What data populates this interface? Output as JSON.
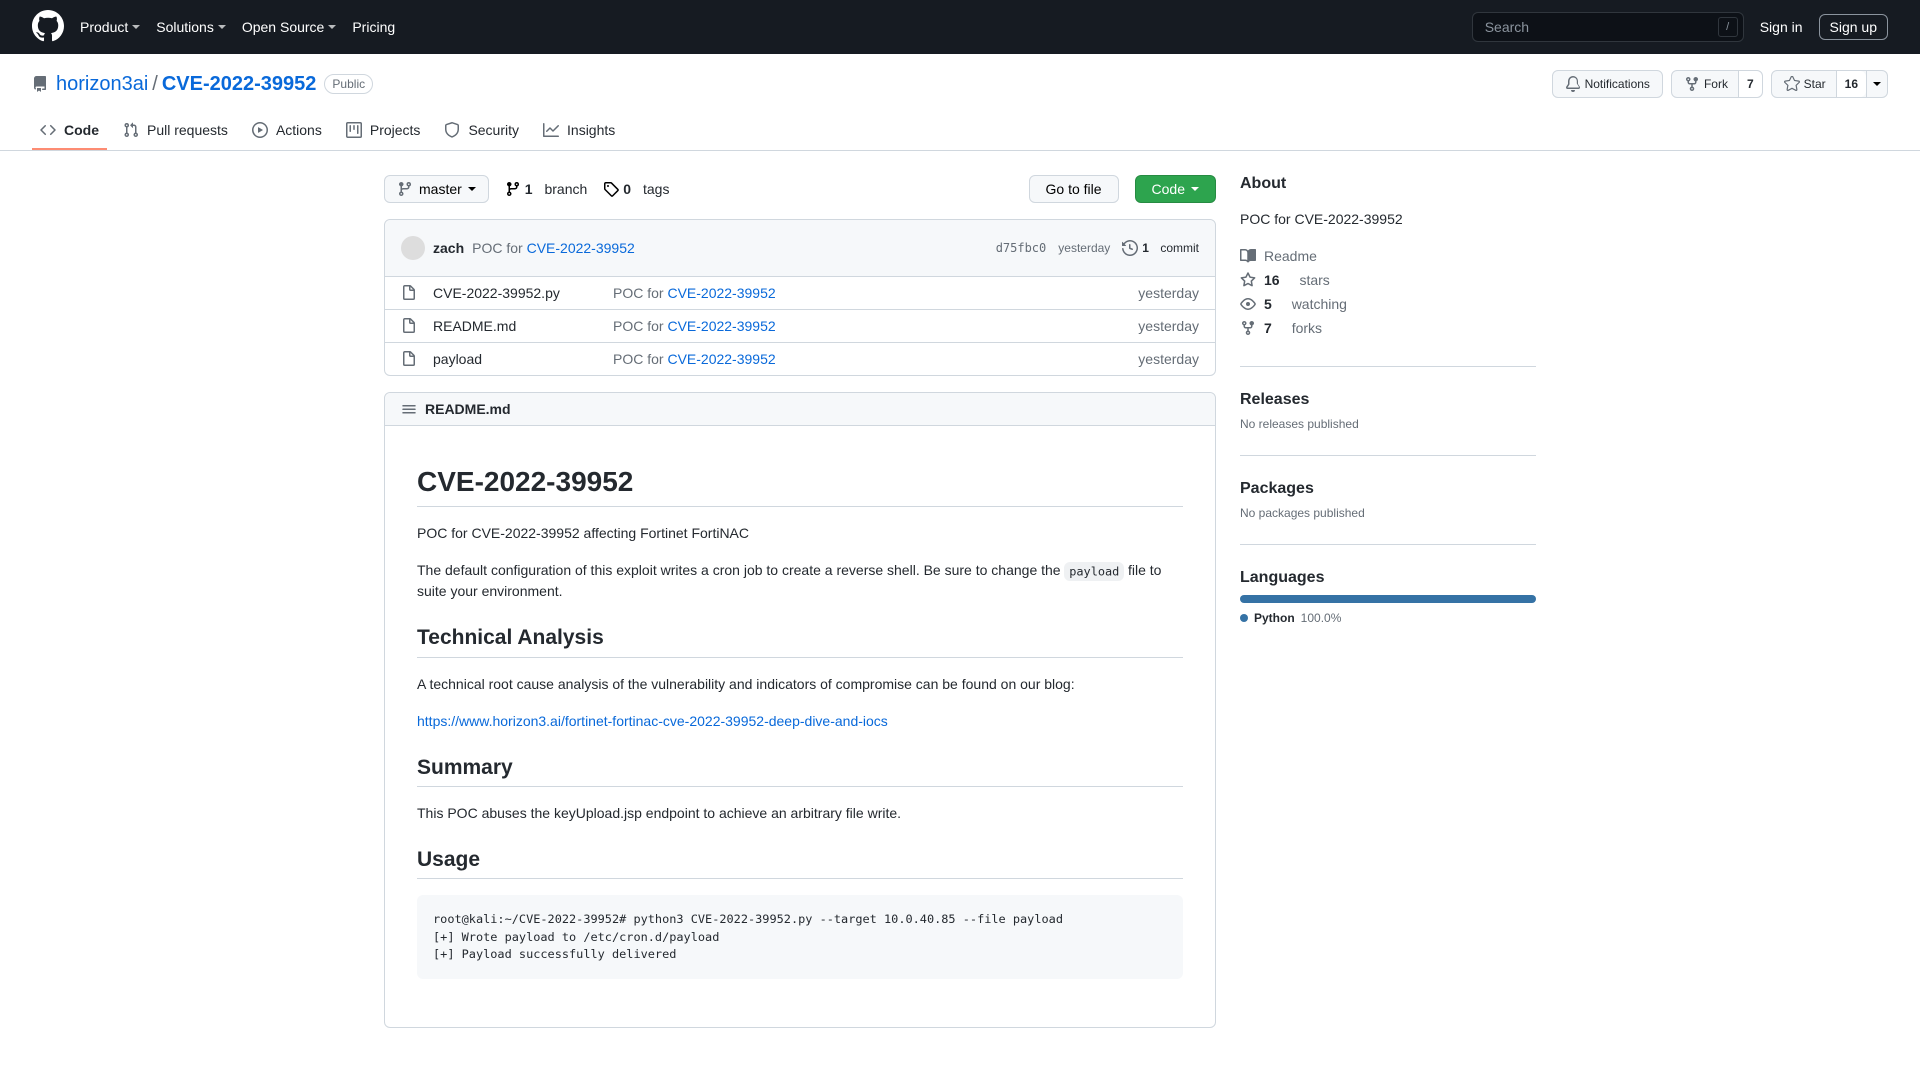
{
  "header": {
    "nav": [
      "Product",
      "Solutions",
      "Open Source",
      "Pricing"
    ],
    "search_placeholder": "Search",
    "signin": "Sign in",
    "signup": "Sign up"
  },
  "repo": {
    "owner": "horizon3ai",
    "name": "CVE-2022-39952",
    "badge": "Public",
    "actions": {
      "notifications": "Notifications",
      "fork": "Fork",
      "fork_count": "7",
      "star": "Star",
      "star_count": "16"
    }
  },
  "tabs": {
    "code": "Code",
    "pull_requests": "Pull requests",
    "actions": "Actions",
    "projects": "Projects",
    "security": "Security",
    "insights": "Insights"
  },
  "toolbar": {
    "branch": "master",
    "branches_count": "1",
    "branches_label": "branch",
    "tags_count": "0",
    "tags_label": "tags",
    "gotofile": "Go to file",
    "code": "Code"
  },
  "commit": {
    "author": "zach",
    "msg_prefix": "POC for ",
    "msg_link": "CVE-2022-39952",
    "sha": "d75fbc0",
    "date": "yesterday",
    "commits_count": "1",
    "commits_label": "commit"
  },
  "files": [
    {
      "name": "CVE-2022-39952.py",
      "msg_prefix": "POC for ",
      "msg_link": "CVE-2022-39952",
      "date": "yesterday"
    },
    {
      "name": "README.md",
      "msg_prefix": "POC for ",
      "msg_link": "CVE-2022-39952",
      "date": "yesterday"
    },
    {
      "name": "payload",
      "msg_prefix": "POC for ",
      "msg_link": "CVE-2022-39952",
      "date": "yesterday"
    }
  ],
  "readme": {
    "filename": "README.md",
    "h1": "CVE-2022-39952",
    "p1": "POC for CVE-2022-39952 affecting Fortinet FortiNAC",
    "p2a": "The default configuration of this exploit writes a cron job to create a reverse shell. Be sure to change the ",
    "p2_code": "payload",
    "p2b": " file to suite your environment.",
    "h2_tech": "Technical Analysis",
    "p3": "A technical root cause analysis of the vulnerability and indicators of compromise can be found on our blog:",
    "link": "https://www.horizon3.ai/fortinet-fortinac-cve-2022-39952-deep-dive-and-iocs",
    "h2_summary": "Summary",
    "p4": "This POC abuses the keyUpload.jsp endpoint to achieve an arbitrary file write.",
    "h2_usage": "Usage",
    "code": "root@kali:~/CVE-2022-39952# python3 CVE-2022-39952.py --target 10.0.40.85 --file payload\n[+] Wrote payload to /etc/cron.d/payload\n[+] Payload successfully delivered"
  },
  "about": {
    "title": "About",
    "desc": "POC for CVE-2022-39952",
    "readme": "Readme",
    "stars_count": "16",
    "stars_label": "stars",
    "watching_count": "5",
    "watching_label": "watching",
    "forks_count": "7",
    "forks_label": "forks"
  },
  "releases": {
    "title": "Releases",
    "none": "No releases published"
  },
  "packages": {
    "title": "Packages",
    "none": "No packages published"
  },
  "languages": {
    "title": "Languages",
    "name": "Python",
    "pct": "100.0%"
  }
}
